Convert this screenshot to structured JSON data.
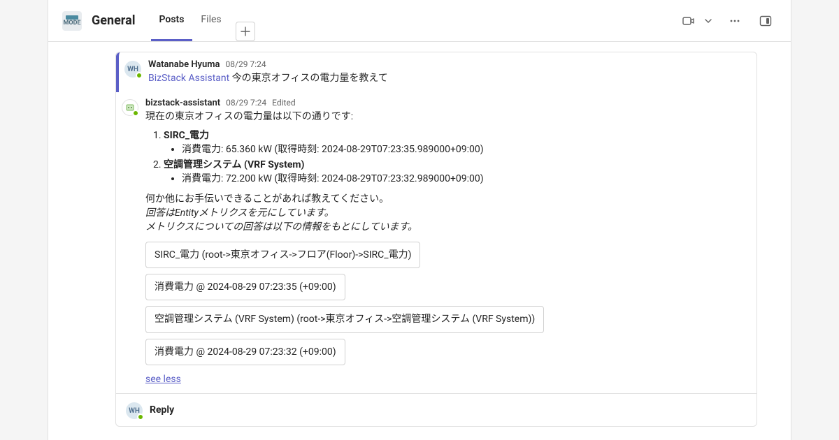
{
  "header": {
    "channel_name": "General",
    "tabs": [
      "Posts",
      "Files"
    ]
  },
  "thread": {
    "user_msg": {
      "author": "Watanabe Hyuma",
      "initials": "WH",
      "timestamp": "08/29 7:24",
      "mention": "BizStack Assistant",
      "text": "今の東京オフィスの電力量を教えて"
    },
    "bot_msg": {
      "author": "bizstack-assistant",
      "timestamp": "08/29 7:24",
      "edited_label": "Edited",
      "intro": "現在の東京オフィスの電力量は以下の通りです:",
      "items": [
        {
          "name": "SIRC_電力",
          "detail": "消費電力: 65.360 kW (取得時刻: 2024-08-29T07:23:35.989000+09:00)"
        },
        {
          "name": "空調管理システム (VRF System)",
          "detail": "消費電力: 72.200 kW (取得時刻: 2024-08-29T07:23:32.989000+09:00)"
        }
      ],
      "closing": "何か他にお手伝いできることがあれば教えてください。",
      "note1": "回答はEntityメトリクスを元にしています。",
      "note2": "メトリクスについての回答は以下の情報をもとにしています。",
      "chips": [
        "SIRC_電力 (root->東京オフィス->フロア(Floor)->SIRC_電力)",
        "消費電力 @ 2024-08-29 07:23:35 (+09:00)",
        "空調管理システム (VRF System) (root->東京オフィス->空調管理システム (VRF System))",
        "消費電力 @ 2024-08-29 07:23:32 (+09:00)"
      ],
      "see_less": "see less"
    },
    "reply_label": "Reply",
    "reply_initials": "WH"
  }
}
